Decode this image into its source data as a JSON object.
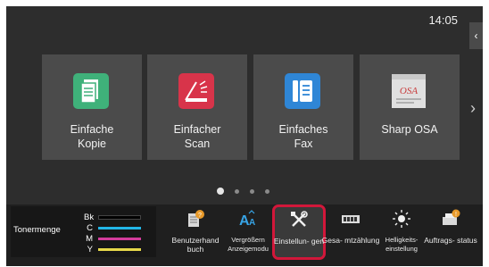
{
  "status": {
    "time": "14:05"
  },
  "side_tab": {
    "icon": "chevron-left-icon",
    "glyph": "‹"
  },
  "tiles": [
    {
      "line1": "Einfache",
      "line2": "Kopie",
      "icon": "copy-icon",
      "color": "#3fb17a"
    },
    {
      "line1": "Einfacher",
      "line2": "Scan",
      "icon": "scan-icon",
      "color": "#d8344a"
    },
    {
      "line1": "Einfaches",
      "line2": "Fax",
      "icon": "fax-icon",
      "color": "#2f86d6"
    },
    {
      "line1": "Sharp OSA",
      "line2": "",
      "icon": "sharp-osa-icon",
      "color": "#e0e0e0"
    }
  ],
  "next_arrow": {
    "icon": "chevron-right-icon",
    "glyph": "›"
  },
  "pager": {
    "pages": 4,
    "active": 0
  },
  "toner": {
    "label": "Tonermenge",
    "channels": [
      {
        "code": "Bk",
        "color": "#000000"
      },
      {
        "code": "C",
        "color": "#22b6e8"
      },
      {
        "code": "M",
        "color": "#d43c9c"
      },
      {
        "code": "Y",
        "color": "#e7d84a"
      }
    ]
  },
  "shortcuts": [
    {
      "label": "Benutzerhand buch",
      "icon": "user-manual-icon"
    },
    {
      "label": "Vergrößern Anzeigemodu",
      "icon": "enlarge-display-icon"
    },
    {
      "label": "Einstellun- gen",
      "icon": "settings-tools-icon",
      "selected": true
    },
    {
      "label": "Gesa- mtzählung",
      "icon": "total-count-icon"
    },
    {
      "label": "Helligkeits- einstellung",
      "icon": "brightness-icon"
    },
    {
      "label": "Auftrags- status",
      "icon": "job-status-icon"
    }
  ]
}
